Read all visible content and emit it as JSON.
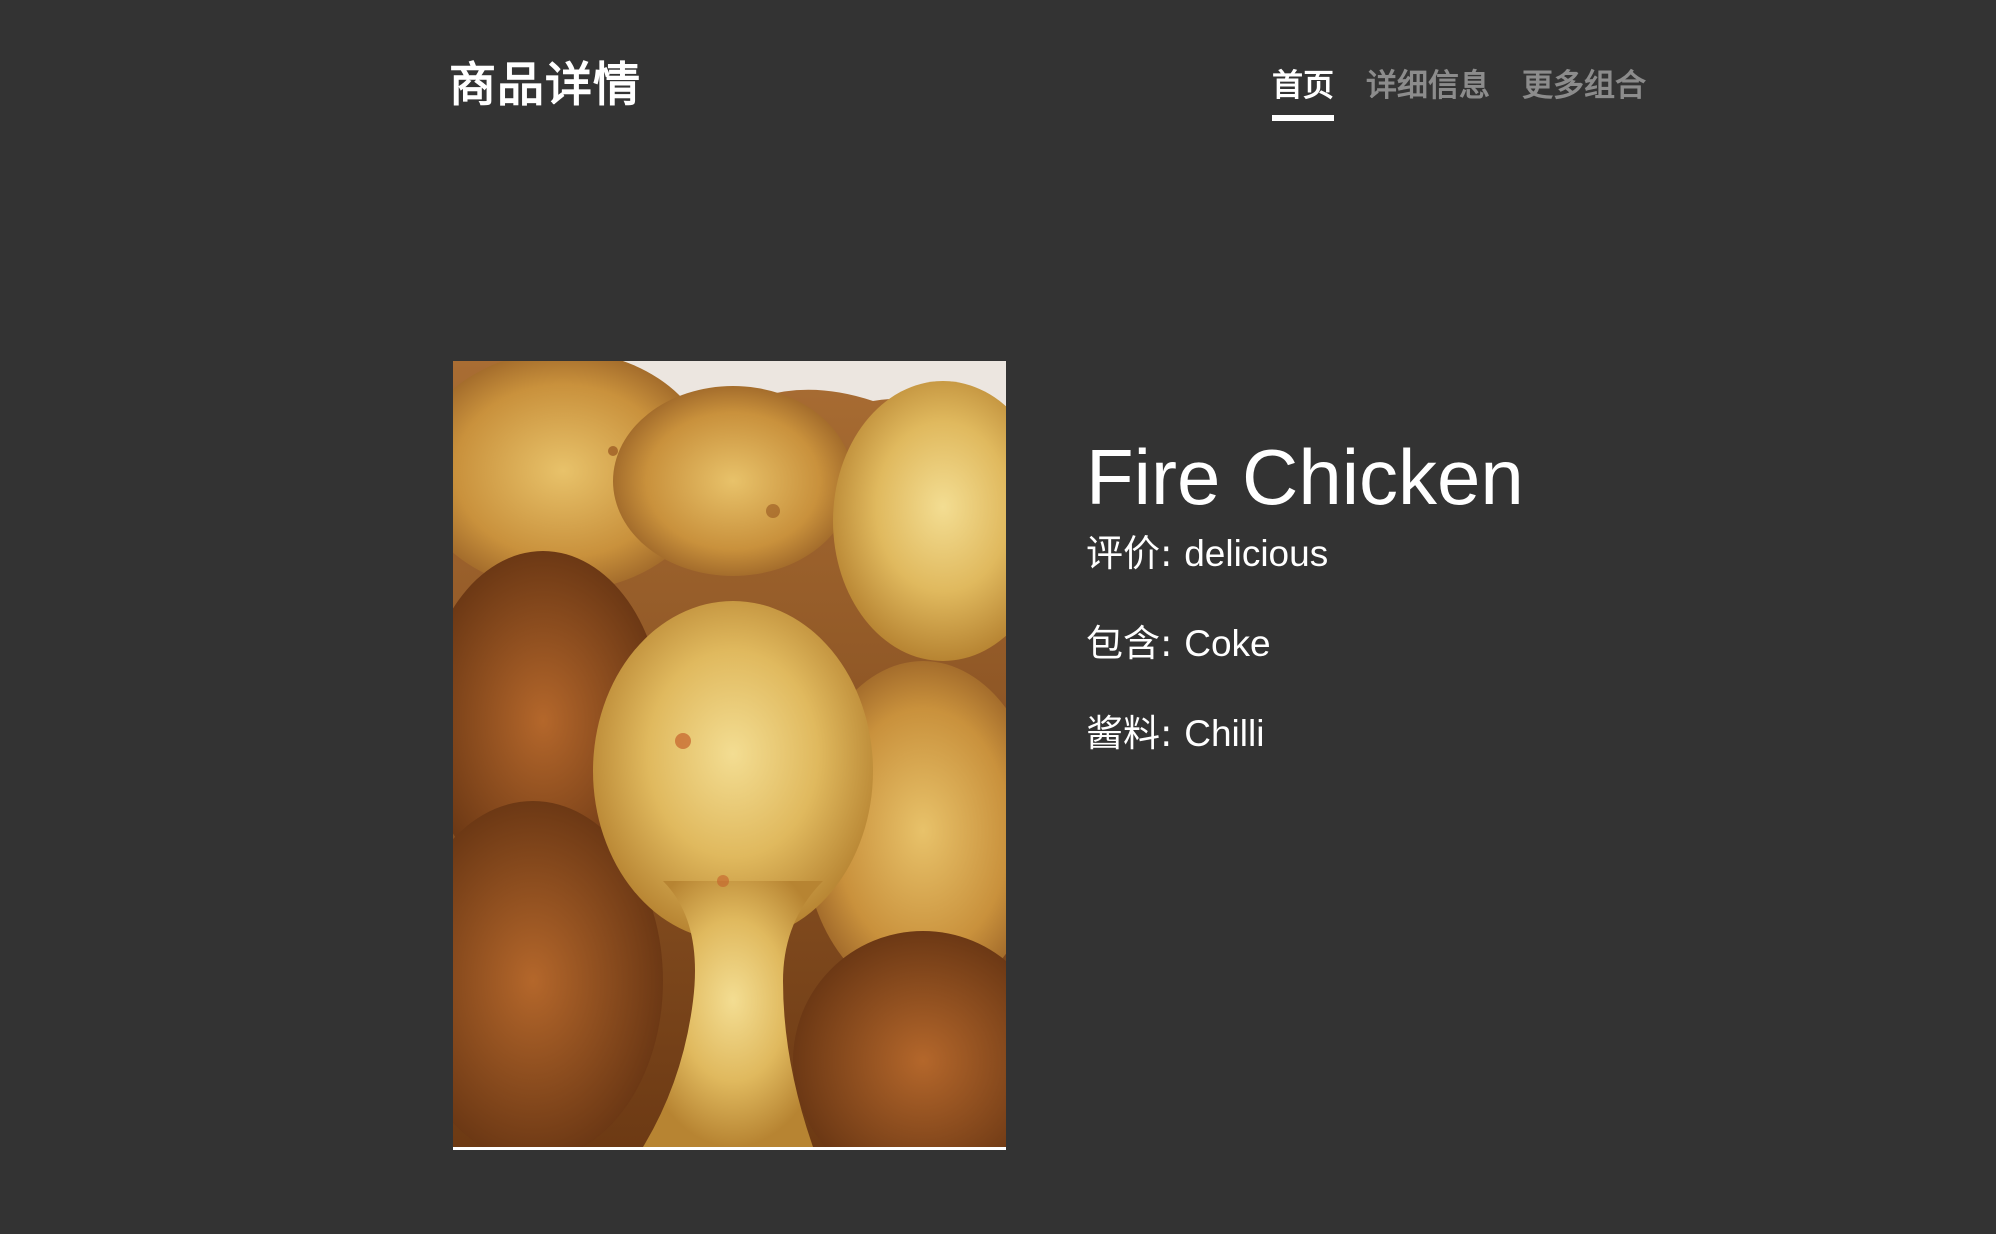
{
  "header": {
    "brand": "商品详情",
    "nav": [
      {
        "label": "首页",
        "active": true
      },
      {
        "label": "详细信息",
        "active": false
      },
      {
        "label": "更多组合",
        "active": false
      }
    ]
  },
  "product": {
    "name": "Fire Chicken",
    "image_icon": "fried-chicken-photo",
    "attributes": [
      {
        "label": "评价",
        "value": "delicious"
      },
      {
        "label": "包含",
        "value": "Coke"
      },
      {
        "label": "酱料",
        "value": "Chilli"
      }
    ]
  },
  "colors": {
    "background": "#333333",
    "text": "#ffffff",
    "nav_inactive": "#8c8c8c",
    "nav_underline": "#ffffff"
  }
}
